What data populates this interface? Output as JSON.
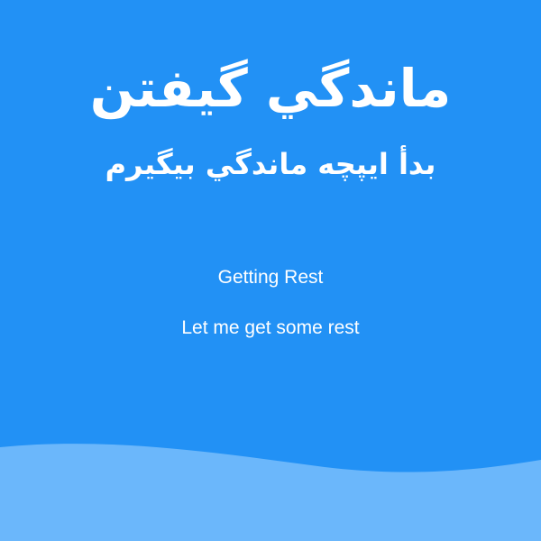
{
  "colors": {
    "background": "#2291f5",
    "wave": "#6bb7fb",
    "text": "#ffffff"
  },
  "card": {
    "title": "ماندگي گيفتن",
    "subtitle": "بدأ ايپچه ماندگي بيگيرم",
    "en_title": "Getting Rest",
    "en_subtitle": "Let me get some rest"
  }
}
